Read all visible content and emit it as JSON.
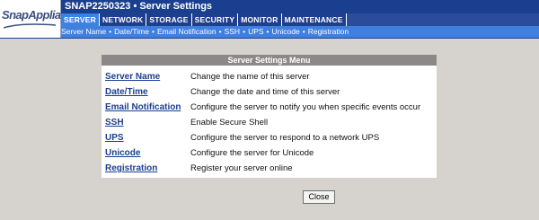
{
  "header": {
    "logo": {
      "text": "SnapAppliance",
      "icon": "snap-appliance-logo"
    },
    "window_title": "SNAP2250323 • Server Settings",
    "tabs": [
      {
        "label": "SERVER",
        "active": true
      },
      {
        "label": "NETWORK",
        "active": false
      },
      {
        "label": "STORAGE",
        "active": false
      },
      {
        "label": "SECURITY",
        "active": false
      },
      {
        "label": "MONITOR",
        "active": false
      },
      {
        "label": "MAINTENANCE",
        "active": false
      }
    ],
    "subnav": {
      "separator": "•",
      "items": [
        "Server Name",
        "Date/Time",
        "Email Notification",
        "SSH",
        "UPS",
        "Unicode",
        "Registration"
      ]
    }
  },
  "menu": {
    "title": "Server Settings Menu",
    "rows": [
      {
        "link": "Server Name",
        "description": "Change the name of this server"
      },
      {
        "link": "Date/Time",
        "description": "Change the date and time of this server"
      },
      {
        "link": "Email Notification",
        "description": "Configure the server to notify you when specific events occur"
      },
      {
        "link": "SSH",
        "description": "Enable Secure Shell"
      },
      {
        "link": "UPS",
        "description": "Configure the server to respond to a network UPS"
      },
      {
        "link": "Unicode",
        "description": "Configure the server for Unicode"
      },
      {
        "link": "Registration",
        "description": "Register your server online"
      }
    ]
  },
  "close_label": "Close",
  "colors": {
    "title_bar": "#1a3f8f",
    "tab_active": "#3a83e0",
    "subnav_bar": "#3f7fe0",
    "page_bg": "#d6d3ce",
    "menu_header": "#8a8987",
    "link": "#1a3f8f"
  }
}
